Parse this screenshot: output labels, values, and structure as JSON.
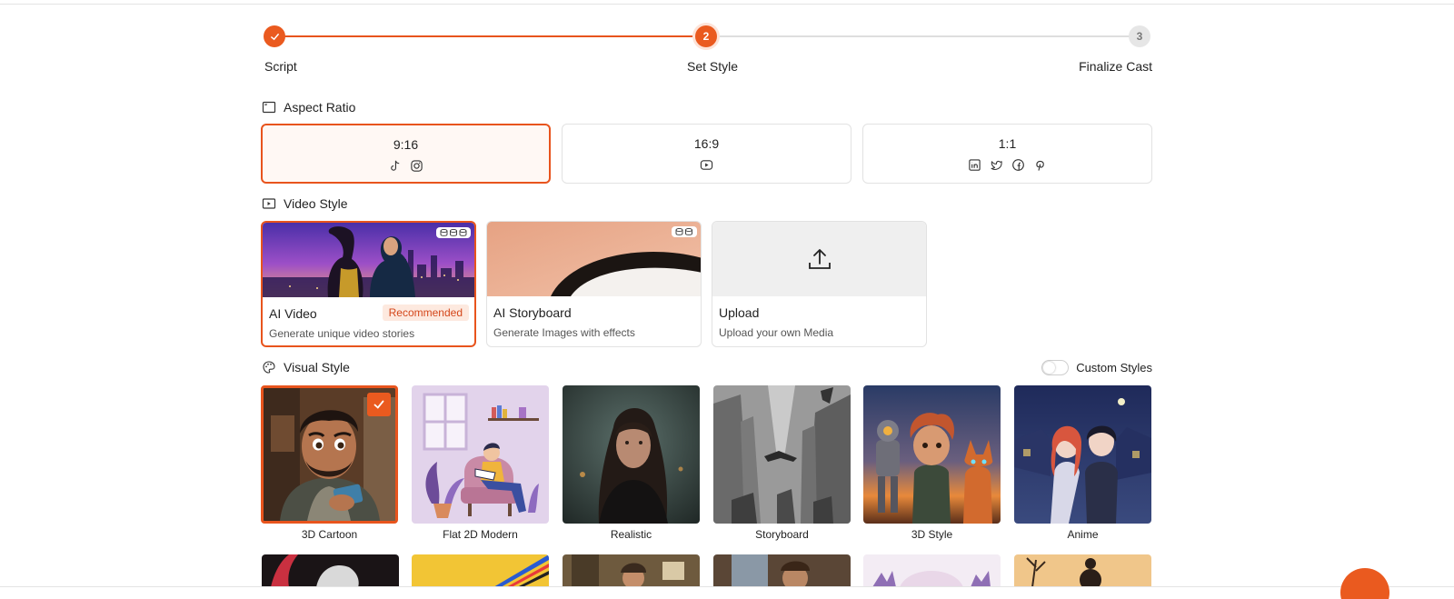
{
  "stepper": {
    "steps": [
      {
        "label": "Script",
        "number": "1",
        "state": "completed"
      },
      {
        "label": "Set Style",
        "number": "2",
        "state": "active"
      },
      {
        "label": "Finalize Cast",
        "number": "3",
        "state": "pending"
      }
    ]
  },
  "aspect_ratio": {
    "title": "Aspect Ratio",
    "options": [
      {
        "ratio": "9:16",
        "icons": [
          "tiktok-icon",
          "instagram-icon"
        ],
        "selected": true
      },
      {
        "ratio": "16:9",
        "icons": [
          "youtube-icon"
        ],
        "selected": false
      },
      {
        "ratio": "1:1",
        "icons": [
          "linkedin-icon",
          "twitter-icon",
          "facebook-icon",
          "pinterest-icon"
        ],
        "selected": false
      }
    ]
  },
  "video_style": {
    "title": "Video Style",
    "options": [
      {
        "title": "AI Video",
        "subtitle": "Generate unique video stories",
        "badge": "Recommended",
        "selected": true
      },
      {
        "title": "AI Storyboard",
        "subtitle": "Generate Images with effects",
        "selected": false
      },
      {
        "title": "Upload",
        "subtitle": "Upload your own Media",
        "selected": false
      }
    ]
  },
  "visual_style": {
    "title": "Visual Style",
    "custom_styles_label": "Custom Styles",
    "custom_styles_enabled": false,
    "options": [
      {
        "label": "3D Cartoon",
        "selected": true
      },
      {
        "label": "Flat 2D Modern",
        "selected": false
      },
      {
        "label": "Realistic",
        "selected": false
      },
      {
        "label": "Storyboard",
        "selected": false
      },
      {
        "label": "3D Style",
        "selected": false
      },
      {
        "label": "Anime",
        "selected": false
      }
    ]
  },
  "colors": {
    "accent": "#e8541d",
    "accent_light": "#fde9df"
  }
}
